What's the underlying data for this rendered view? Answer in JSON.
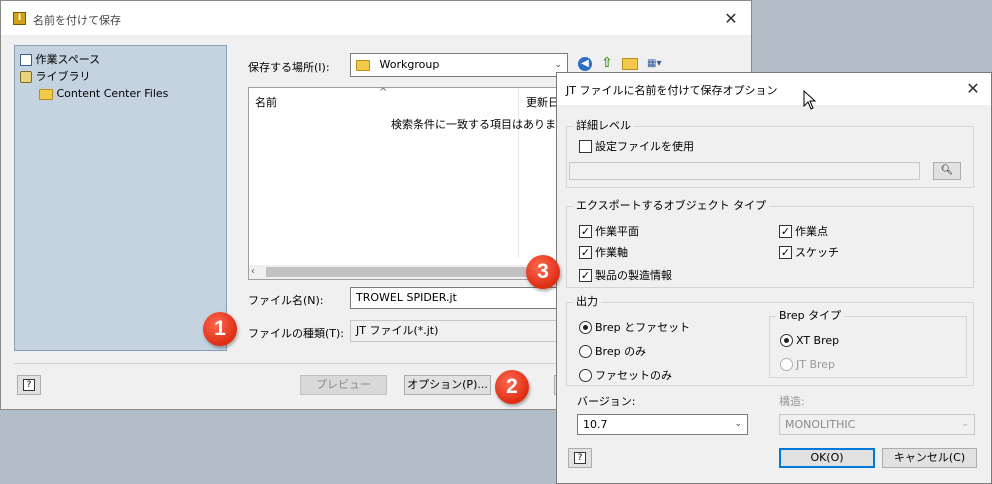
{
  "save_dialog": {
    "title": "名前を付けて保存",
    "nav_tree": [
      {
        "label": "作業スペース",
        "icon": "workspace-icon"
      },
      {
        "label": "ライブラリ",
        "icon": "library-icon"
      },
      {
        "label": "Content Center Files",
        "icon": "folder-icon"
      }
    ],
    "location_label": "保存する場所(I):",
    "location_value": "Workgroup",
    "file_list": {
      "col_name": "名前",
      "col_modified": "更新日",
      "empty_message": "検索条件に一致する項目はありま"
    },
    "filename_label": "ファイル名(N):",
    "filename_value": "TROWEL SPIDER.jt",
    "filetype_label": "ファイルの種類(T):",
    "filetype_value": "JT ファイル(*.jt)",
    "preview_button": "プレビュー",
    "options_button": "オプション(P)...",
    "help": "?"
  },
  "jt_dialog": {
    "title": "JT ファイルに名前を付けて保存オプション",
    "detail_level": {
      "title": "詳細レベル",
      "use_config_label": "設定ファイルを使用",
      "use_config_checked": false,
      "config_path": ""
    },
    "export_types": {
      "title": "エクスポートするオブジェクト タイプ",
      "items": [
        {
          "label": "作業平面",
          "checked": true
        },
        {
          "label": "作業点",
          "checked": true
        },
        {
          "label": "作業軸",
          "checked": true
        },
        {
          "label": "スケッチ",
          "checked": true
        },
        {
          "label": "製品の製造情報",
          "checked": true
        }
      ]
    },
    "output": {
      "title": "出力",
      "options": [
        {
          "label": "Brep とファセット",
          "selected": true
        },
        {
          "label": "Brep のみ",
          "selected": false
        },
        {
          "label": "ファセットのみ",
          "selected": false
        }
      ]
    },
    "brep_type": {
      "title": "Brep タイプ",
      "options": [
        {
          "label": "XT Brep",
          "selected": true,
          "enabled": true
        },
        {
          "label": "JT Brep",
          "selected": false,
          "enabled": false
        }
      ]
    },
    "version_label": "バージョン:",
    "version_value": "10.7",
    "structure_label": "構造:",
    "structure_value": "MONOLITHIC",
    "ok_button": "OK(O)",
    "cancel_button": "キャンセル(C)",
    "help": "?"
  },
  "callouts": [
    "1",
    "2",
    "3"
  ],
  "colors": {
    "badge": "#dd2d13",
    "tree_bg": "#c5d3e0",
    "dialog_bg": "#f0f0f0"
  }
}
